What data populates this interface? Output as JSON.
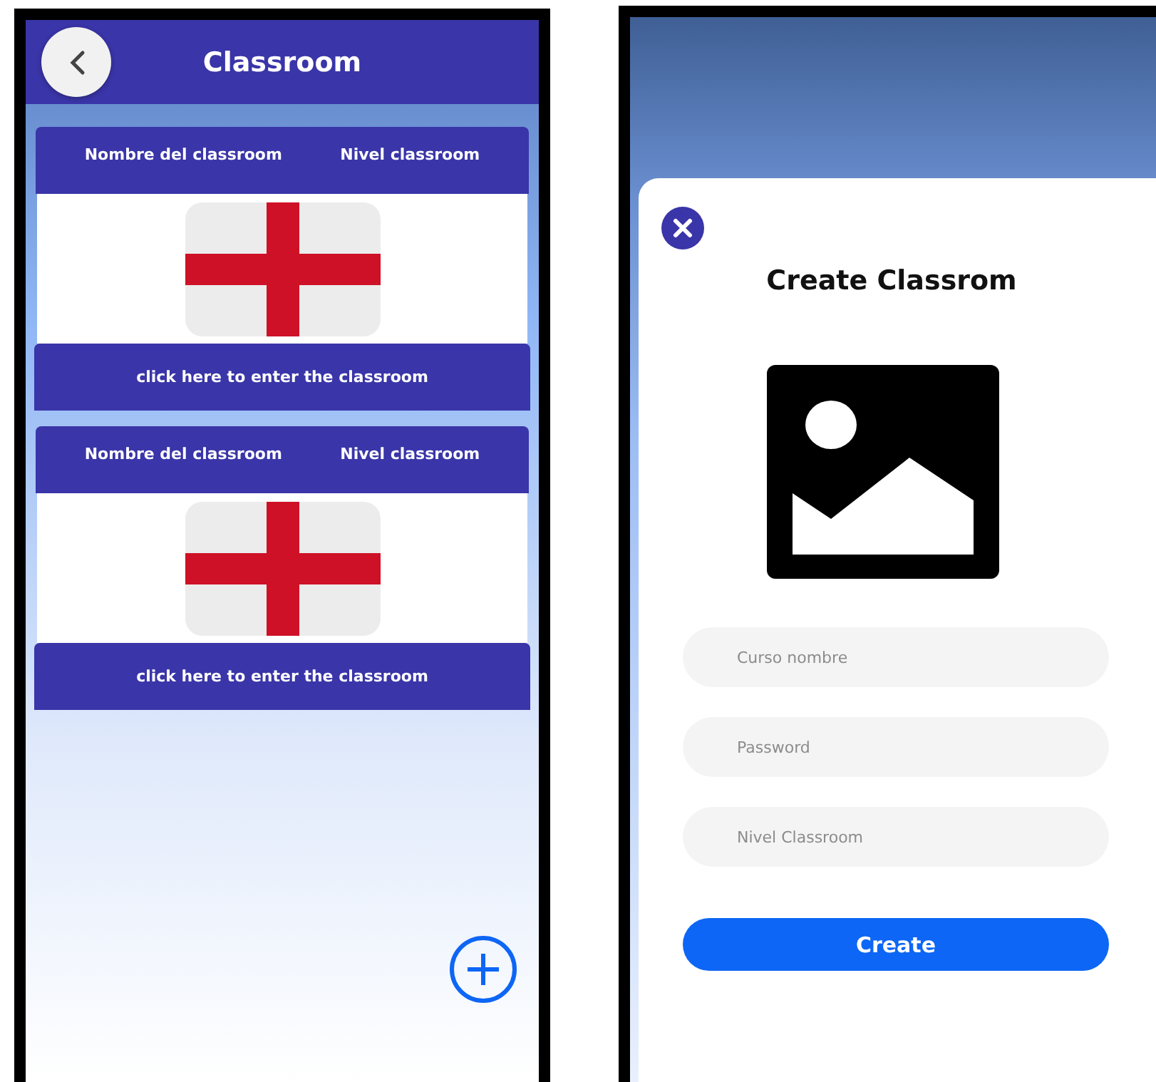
{
  "classroom_screen": {
    "header": {
      "title": "Classroom"
    },
    "cards": [
      {
        "name_label": "Nombre del classroom",
        "level_label": "Nivel classroom",
        "enter_button": "click here to enter the classroom"
      },
      {
        "name_label": "Nombre del classroom",
        "level_label": "Nivel classroom",
        "enter_button": "click here to enter the classroom"
      }
    ]
  },
  "create_dialog": {
    "title": "Create Classrom",
    "fields": [
      {
        "placeholder": "Curso nombre"
      },
      {
        "placeholder": "Password"
      },
      {
        "placeholder": "Nivel Classroom"
      }
    ],
    "submit_button": "Create"
  }
}
